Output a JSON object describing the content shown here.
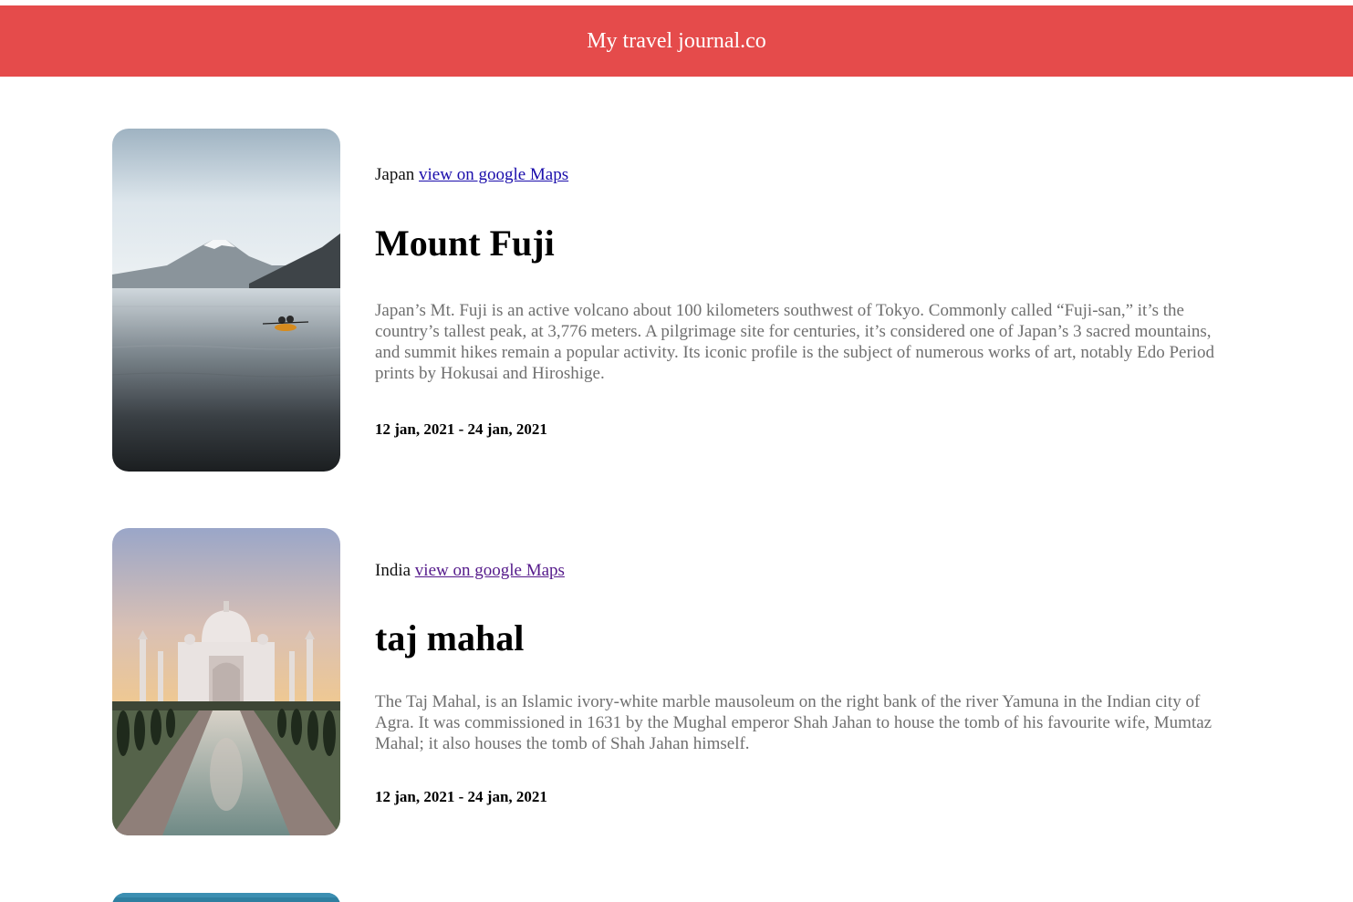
{
  "header": {
    "title": "My travel journal.co",
    "background_color": "#e54b4b"
  },
  "entries": [
    {
      "country": "Japan",
      "map_link_label": "view on google Maps",
      "title": "Mount Fuji",
      "description": "Japan’s Mt. Fuji is an active volcano about 100 kilometers southwest of Tokyo. Commonly called “Fuji-san,” it’s the country’s tallest peak, at 3,776 meters. A pilgrimage site for centuries, it’s considered one of Japan’s 3 sacred mountains, and summit hikes remain a popular activity. Its iconic profile is the subject of numerous works of art, notably Edo Period prints by Hokusai and Hiroshige.",
      "dates": "12 jan, 2021 - 24 jan, 2021",
      "image": "mount-fuji-lake-photo"
    },
    {
      "country": "India",
      "map_link_label": "view on google Maps",
      "title": "taj mahal",
      "description": "The Taj Mahal, is an Islamic ivory-white marble mausoleum on the right bank of the river Yamuna in the Indian city of Agra. It was commissioned in 1631 by the Mughal emperor Shah Jahan to house the tomb of his favourite wife, Mumtaz Mahal; it also houses the tomb of Shah Jahan himself.",
      "dates": "12 jan, 2021 - 24 jan, 2021",
      "image": "taj-mahal-photo"
    },
    {
      "image": "third-destination-photo-partial"
    }
  ]
}
